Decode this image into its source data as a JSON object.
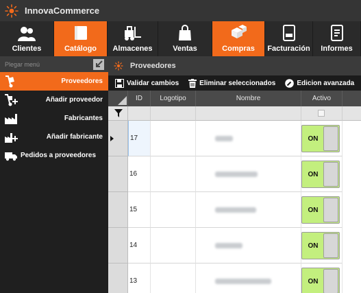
{
  "app": {
    "title": "InnovaCommerce",
    "logo_icon": "sun-logo-icon"
  },
  "topnav": {
    "items": [
      {
        "label": "Clientes",
        "icon": "users-icon",
        "active": false
      },
      {
        "label": "Catálogo",
        "icon": "book-icon",
        "active": true
      },
      {
        "label": "Almacenes",
        "icon": "forklift-icon",
        "active": false
      },
      {
        "label": "Ventas",
        "icon": "shopping-bag-icon",
        "active": false
      },
      {
        "label": "Compras",
        "icon": "boxes-icon",
        "active": true
      },
      {
        "label": "Facturación",
        "icon": "invoice-icon",
        "active": false
      },
      {
        "label": "Informes",
        "icon": "report-icon",
        "active": false
      }
    ]
  },
  "sidebar": {
    "collapse_label": "Plegar menú",
    "items": [
      {
        "label": "Proveedores",
        "icon": "hand-truck-icon",
        "active": true
      },
      {
        "label": "Añadir proveedor",
        "icon": "hand-truck-add-icon",
        "active": false
      },
      {
        "label": "Fabricantes",
        "icon": "factory-icon",
        "active": false
      },
      {
        "label": "Añadir fabricante",
        "icon": "factory-add-icon",
        "active": false
      },
      {
        "label": "Pedidos a proveedores",
        "icon": "delivery-truck-icon",
        "active": false
      }
    ]
  },
  "panel": {
    "title": "Proveedores"
  },
  "toolbar": {
    "validate_label": "Validar cambios",
    "delete_label": "Eliminar seleccionados",
    "advanced_label": "Edicion avanzada"
  },
  "grid": {
    "columns": [
      "ID",
      "Logotipo",
      "Nombre",
      "Activo"
    ],
    "rows": [
      {
        "id": "17",
        "active": "ON",
        "current": true
      },
      {
        "id": "16",
        "active": "ON",
        "current": false
      },
      {
        "id": "15",
        "active": "ON",
        "current": false
      },
      {
        "id": "14",
        "active": "ON",
        "current": false
      },
      {
        "id": "13",
        "active": "ON",
        "current": false
      }
    ]
  },
  "colors": {
    "accent": "#f26a1b",
    "toggle_on": "#c3ef7e",
    "dark": "#2a2a2a"
  }
}
